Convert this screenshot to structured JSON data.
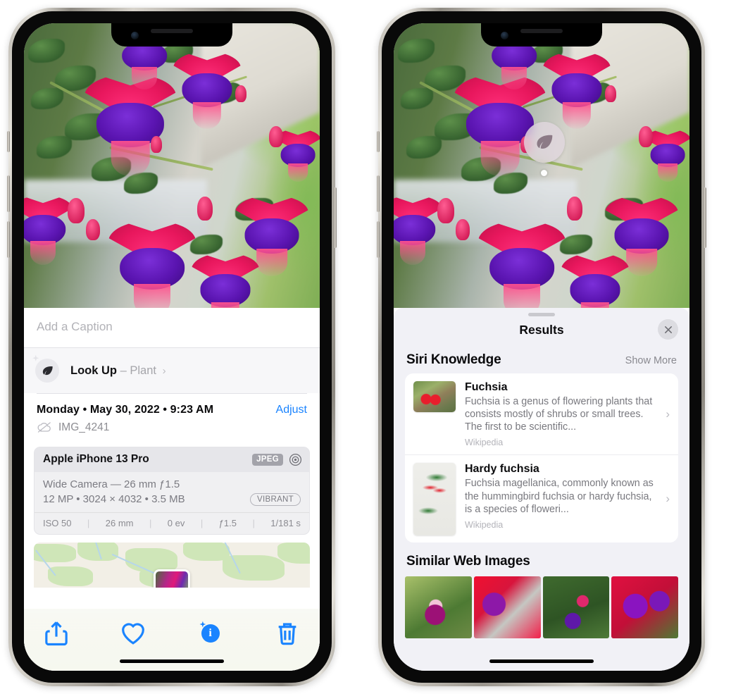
{
  "left_phone": {
    "caption_placeholder": "Add a Caption",
    "lookup": {
      "label": "Look Up",
      "dash": "–",
      "subject": "Plant",
      "chevron": "›",
      "icon": "leaf-icon"
    },
    "metadata": {
      "date": "Monday • May 30, 2022 • 9:23 AM",
      "adjust_label": "Adjust",
      "filename": "IMG_4241",
      "cloud_icon": "cloud-slash-icon"
    },
    "exif": {
      "model": "Apple iPhone 13 Pro",
      "format_badge": "JPEG",
      "aperture_icon": "aperture-icon",
      "lens_line": "Wide Camera — 26 mm ƒ1.5",
      "spec_line": "12 MP • 3024 × 4032 • 3.5 MB",
      "style_pill": "VIBRANT",
      "settings": [
        "ISO 50",
        "26 mm",
        "0 ev",
        "ƒ1.5",
        "1/181 s"
      ]
    },
    "toolbar": [
      {
        "name": "share-button",
        "icon": "share-icon"
      },
      {
        "name": "favorite-button",
        "icon": "heart-icon"
      },
      {
        "name": "info-button",
        "icon": "info-sparkle-icon"
      },
      {
        "name": "delete-button",
        "icon": "trash-icon"
      }
    ]
  },
  "right_phone": {
    "visual_lookup_badge": {
      "icon": "leaf-icon"
    },
    "sheet": {
      "title": "Results",
      "close_icon": "close-icon"
    },
    "siri_knowledge": {
      "heading": "Siri Knowledge",
      "show_more": "Show More",
      "items": [
        {
          "title": "Fuchsia",
          "description": "Fuchsia is a genus of flowering plants that consists mostly of shrubs or small trees. The first to be scientific...",
          "source": "Wikipedia",
          "chevron": "›"
        },
        {
          "title": "Hardy fuchsia",
          "description": "Fuchsia magellanica, commonly known as the hummingbird fuchsia or hardy fuchsia, is a species of floweri...",
          "source": "Wikipedia",
          "chevron": "›"
        }
      ]
    },
    "similar_web_images": {
      "heading": "Similar Web Images",
      "count": 4
    }
  },
  "colors": {
    "accent_blue": "#1a84ff",
    "sheet_background": "#f1f1f6",
    "card_background": "#ffffff",
    "secondary_text": "#8e8e93"
  }
}
